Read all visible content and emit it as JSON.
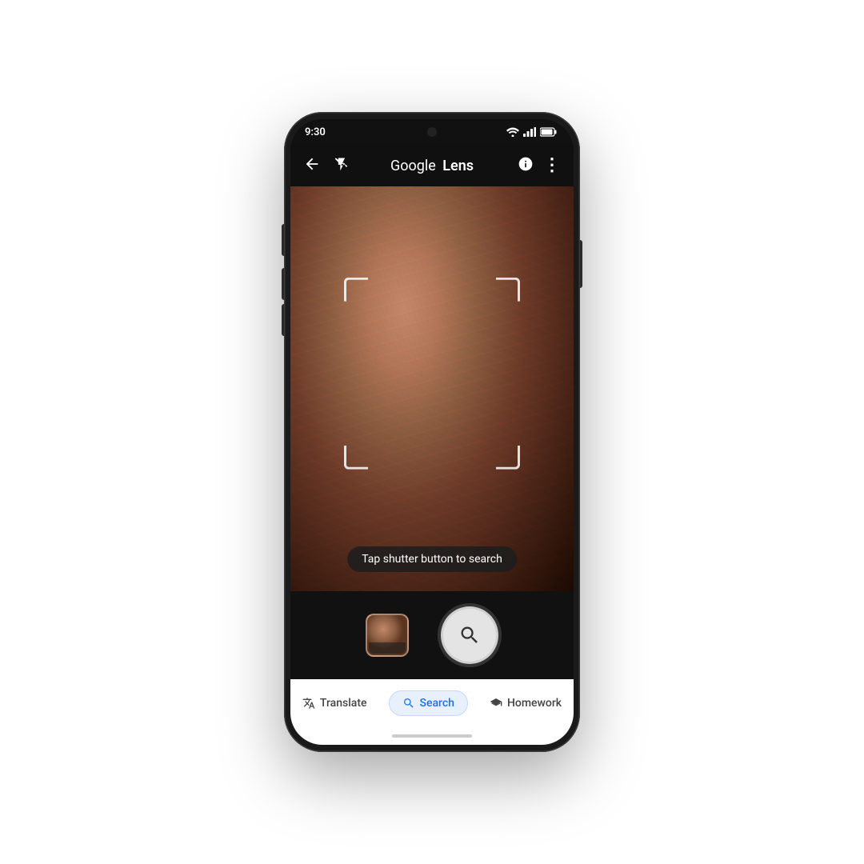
{
  "status_bar": {
    "time": "9:30",
    "wifi": "wifi",
    "signal": "signal",
    "battery": "battery"
  },
  "app_bar": {
    "back_label": "←",
    "flash_off_label": "flash_off",
    "title_google": "Google",
    "title_lens": "Lens",
    "info_label": "ℹ",
    "more_label": "⋮"
  },
  "viewfinder": {
    "hint_text": "Tap shutter button to search"
  },
  "shutter_row": {
    "shutter_icon": "🔍"
  },
  "mode_tabs": {
    "translate": {
      "label": "Translate",
      "icon": "🔤"
    },
    "search": {
      "label": "Search",
      "icon": "🔍",
      "active": true
    },
    "homework": {
      "label": "Homework",
      "icon": "🎓"
    }
  }
}
